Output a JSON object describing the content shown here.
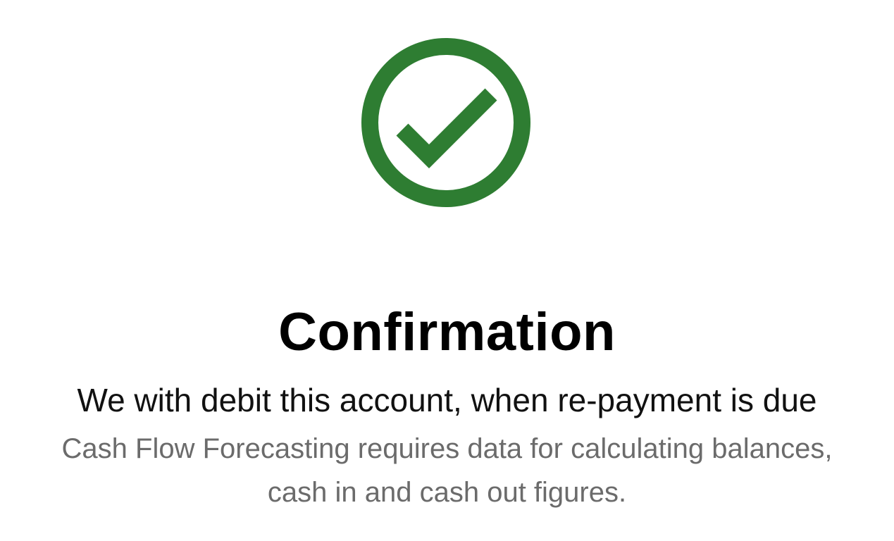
{
  "confirmation": {
    "icon": "check-circle-icon",
    "icon_color": "#2e7d32",
    "title": "Confirmation",
    "message": "We with debit this account, when re-payment is due",
    "description": "Cash Flow Forecasting requires data for calculating balances, cash in and cash out figures."
  },
  "colors": {
    "title": "#000000",
    "message": "#111111",
    "description": "#6b6b6b",
    "background": "#ffffff"
  }
}
